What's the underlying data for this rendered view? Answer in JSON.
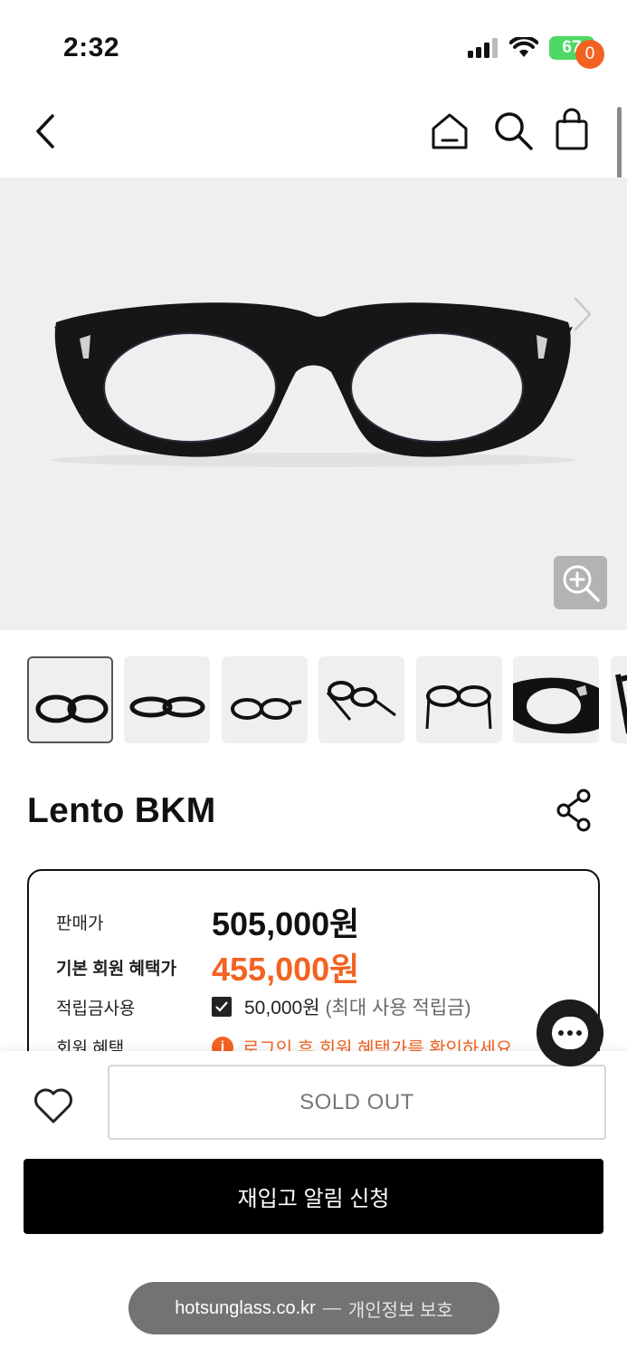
{
  "status_bar": {
    "time": "2:32",
    "battery": "67"
  },
  "nav": {
    "cart_count": "0"
  },
  "product": {
    "title": "Lento BKM",
    "price_label": "판매가",
    "price": "505,000원",
    "member_label": "기본 회원 혜택가",
    "member_price": "455,000원",
    "points_label": "적립금사용",
    "points_value": "50,000원",
    "points_note": "(최대 사용 적립금)",
    "benefit_label": "회원 혜택",
    "benefit_notice": "로그인 후 회원 혜택가를 확인하세요."
  },
  "actions": {
    "sold_out": "SOLD OUT",
    "restock": "재입고 알림 신청"
  },
  "browser": {
    "host": "hotsunglass.co.kr",
    "separator": "—",
    "privacy": "개인정보 보호"
  },
  "colors": {
    "accent": "#f26322",
    "primary_button": "#000000",
    "hero_background": "#efeff0"
  },
  "icons": [
    "back-icon",
    "home-icon",
    "search-icon",
    "cart-icon",
    "chevron-right-icon",
    "zoom-icon",
    "share-icon",
    "heart-icon",
    "chat-icon",
    "info-icon",
    "check-icon"
  ]
}
